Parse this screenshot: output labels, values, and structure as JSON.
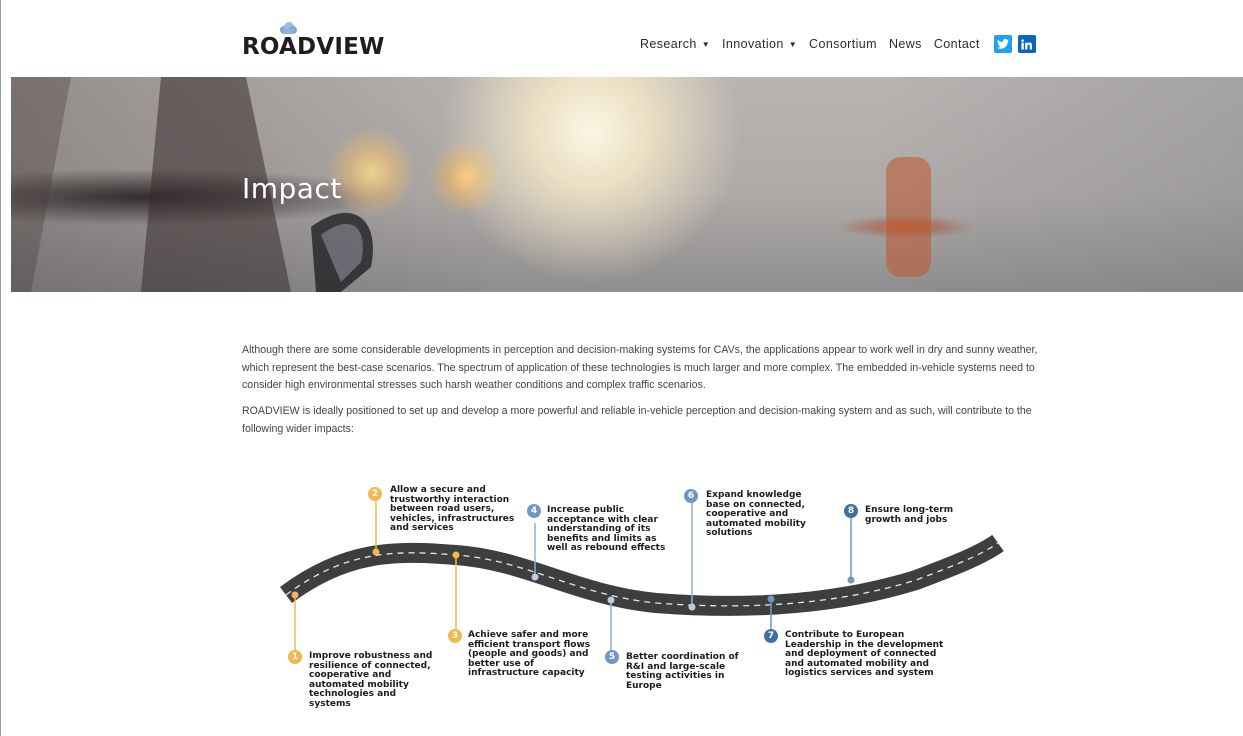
{
  "header": {
    "logo_text": "ROADVIEW",
    "nav": [
      {
        "label": "Research",
        "has_dropdown": true
      },
      {
        "label": "Innovation",
        "has_dropdown": true
      },
      {
        "label": "Consortium",
        "has_dropdown": false
      },
      {
        "label": "News",
        "has_dropdown": false
      },
      {
        "label": "Contact",
        "has_dropdown": false
      }
    ],
    "social": {
      "twitter_icon": "twitter-icon",
      "linkedin_icon": "linkedin-icon",
      "twitter_color": "#1da1f2",
      "linkedin_color": "#0a66c2"
    }
  },
  "hero": {
    "title": "Impact"
  },
  "content": {
    "paragraph_1": "Although there are some considerable developments in perception and decision-making systems for CAVs, the applications appear to work well in dry and sunny weather, which represent the best-case scenarios. The spectrum of application of these technologies is much larger and more complex. The embedded in-vehicle systems need to consider high environmental stresses such harsh weather conditions and complex traffic scenarios.",
    "paragraph_2": "ROADVIEW is ideally positioned to set up and develop a more powerful and reliable in-vehicle perception and decision-making system and as such, will contribute to the following wider impacts:"
  },
  "roadmap": {
    "colors": {
      "yellow": "#f0b84f",
      "light_blue": "#6f97c4",
      "dark_blue": "#416f9e",
      "road": "#4a4a4a"
    },
    "milestones": [
      {
        "number": "1",
        "text": "Improve robustness and resilience of connected, cooperative and automated mobility technologies and systems"
      },
      {
        "number": "2",
        "text": "Allow a secure and trustworthy interaction between road users, vehicles, infrastructures and services"
      },
      {
        "number": "3",
        "text": "Achieve safer and more efficient transport flows (people and goods) and better use of infrastructure capacity"
      },
      {
        "number": "4",
        "text": "Increase public acceptance with clear understanding of its benefits and limits as well as rebound effects"
      },
      {
        "number": "5",
        "text": "Better coordination of R&I and large-scale testing activities in Europe"
      },
      {
        "number": "6",
        "text": "Expand knowledge base on connected, cooperative and automated mobility solutions"
      },
      {
        "number": "7",
        "text": "Contribute to European Leadership in the development and deployment of connected and automated mobility and logistics services and system"
      },
      {
        "number": "8",
        "text": "Ensure long-term growth and jobs"
      }
    ]
  }
}
